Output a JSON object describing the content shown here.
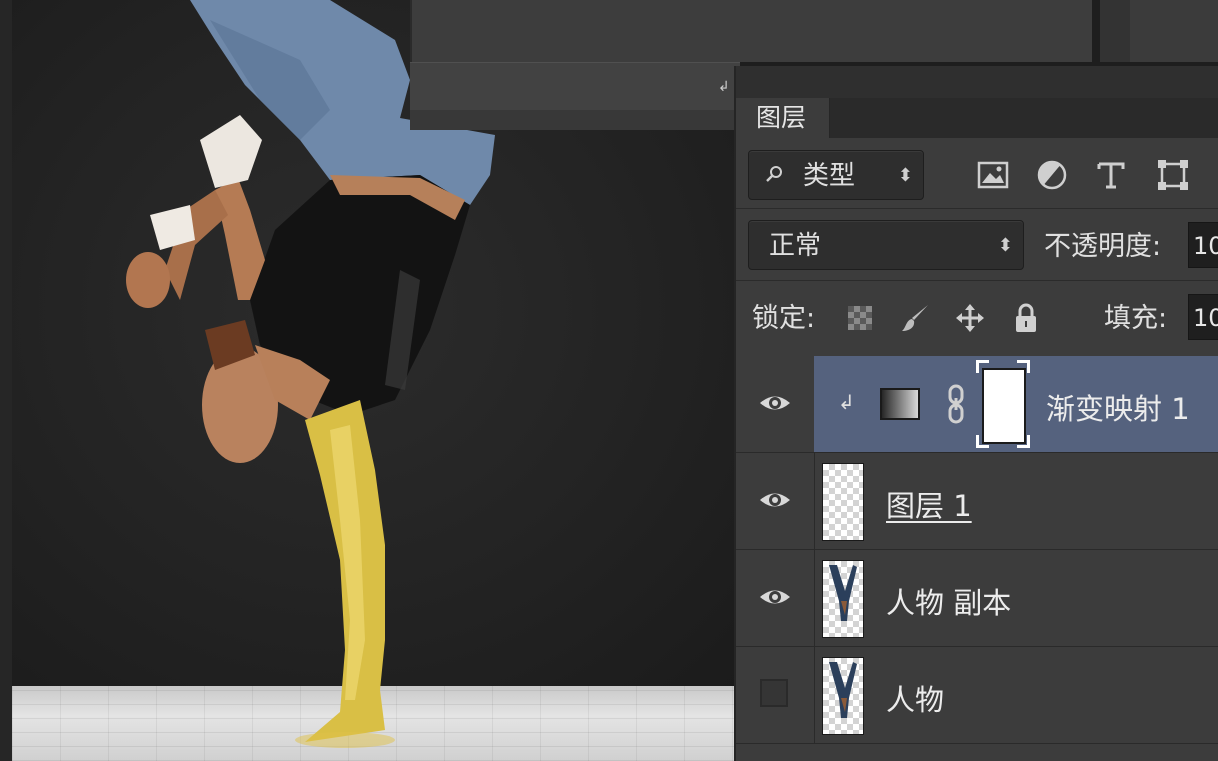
{
  "layers_panel": {
    "tab_label": "图层",
    "filter": {
      "selected": "类型"
    },
    "filter_icons": [
      "image-layer-icon",
      "adjustment-layer-icon",
      "type-layer-icon",
      "shape-layer-icon"
    ],
    "blend_mode": "正常",
    "opacity_label": "不透明度:",
    "opacity_value": "10",
    "lock_label": "锁定:",
    "lock_icons": [
      "lock-transparent-icon",
      "lock-image-icon",
      "lock-position-icon",
      "lock-all-icon"
    ],
    "fill_label": "填充:",
    "fill_value": "10",
    "layers": [
      {
        "name": "渐变映射 1",
        "visible": true,
        "selected": true,
        "clipped": true,
        "type": "gradient-map"
      },
      {
        "name": "图层 1",
        "visible": true,
        "selected": false,
        "type": "pixel"
      },
      {
        "name": "人物 副本",
        "visible": true,
        "selected": false,
        "type": "pixel"
      },
      {
        "name": "人物",
        "visible": false,
        "selected": false,
        "type": "pixel"
      }
    ]
  },
  "colors": {
    "selected_row": "#55627e",
    "panel_bg": "#3c3c3c",
    "highlight_gold": "#d9bf45"
  }
}
